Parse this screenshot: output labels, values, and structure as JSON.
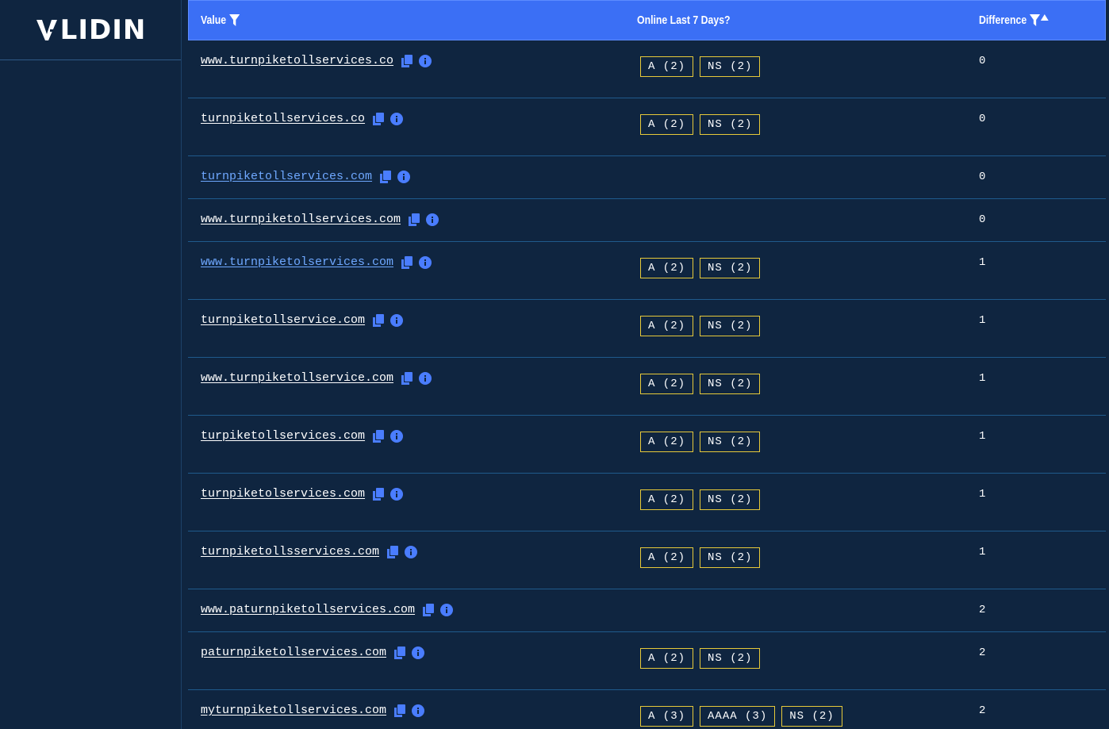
{
  "brand": {
    "name": "LIDIN"
  },
  "table": {
    "headers": {
      "value": "Value",
      "online": "Online Last 7 Days?",
      "difference": "Difference"
    },
    "rows": [
      {
        "domain": "www.turnpiketollservices.co",
        "visited": false,
        "records": [
          "A (2)",
          "NS (2)"
        ],
        "difference": "0"
      },
      {
        "domain": "turnpiketollservices.co",
        "visited": false,
        "records": [
          "A (2)",
          "NS (2)"
        ],
        "difference": "0"
      },
      {
        "domain": "turnpiketollservices.com",
        "visited": true,
        "records": [],
        "difference": "0"
      },
      {
        "domain": "www.turnpiketollservices.com",
        "visited": false,
        "records": [],
        "difference": "0"
      },
      {
        "domain": "www.turnpiketolservices.com",
        "visited": true,
        "records": [
          "A (2)",
          "NS (2)"
        ],
        "difference": "1"
      },
      {
        "domain": "turnpiketollservice.com",
        "visited": false,
        "records": [
          "A (2)",
          "NS (2)"
        ],
        "difference": "1"
      },
      {
        "domain": "www.turnpiketollservice.com",
        "visited": false,
        "records": [
          "A (2)",
          "NS (2)"
        ],
        "difference": "1"
      },
      {
        "domain": "turpiketollservices.com",
        "visited": false,
        "records": [
          "A (2)",
          "NS (2)"
        ],
        "difference": "1"
      },
      {
        "domain": "turnpiketolservices.com",
        "visited": false,
        "records": [
          "A (2)",
          "NS (2)"
        ],
        "difference": "1"
      },
      {
        "domain": "turnpiketollsservices.com",
        "visited": false,
        "records": [
          "A (2)",
          "NS (2)"
        ],
        "difference": "1"
      },
      {
        "domain": "www.paturnpiketollservices.com",
        "visited": false,
        "records": [],
        "difference": "2"
      },
      {
        "domain": "paturnpiketollservices.com",
        "visited": false,
        "records": [
          "A (2)",
          "NS (2)"
        ],
        "difference": "2"
      },
      {
        "domain": "myturnpiketollservices.com",
        "visited": false,
        "records": [
          "A (3)",
          "AAAA (3)",
          "NS (2)"
        ],
        "difference": "2"
      }
    ]
  },
  "icons": {
    "copy": "copy-icon",
    "info": "info-icon",
    "filter": "filter-icon",
    "sort": "sort-asc-icon"
  },
  "colors": {
    "background": "#0f2540",
    "header": "#3b6ff5",
    "badge_border": "#e6c93a",
    "visited_link": "#6fa8ff",
    "icon": "#4a7dff"
  }
}
